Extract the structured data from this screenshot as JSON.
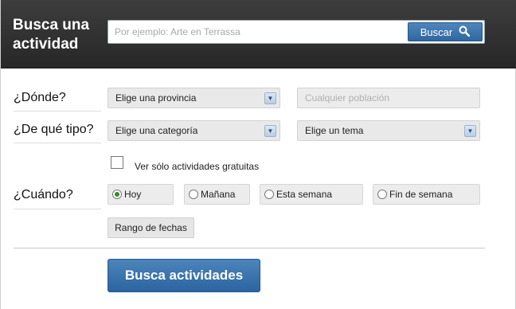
{
  "header": {
    "title": "Busca una actividad",
    "search_placeholder": "Por ejemplo: Arte en Terrassa",
    "search_button": "Buscar"
  },
  "where": {
    "label": "¿Dónde?",
    "province": "Elige una provincia",
    "town_placeholder": "Cualquier población"
  },
  "type": {
    "label": "¿De qué tipo?",
    "category": "Elige una categoría",
    "topic": "Elige un tema"
  },
  "free_only": {
    "label": "Ver sólo actividades gratuitas",
    "checked": false
  },
  "when": {
    "label": "¿Cuándo?",
    "options": [
      {
        "label": "Hoy",
        "checked": true
      },
      {
        "label": "Mañana",
        "checked": false
      },
      {
        "label": "Esta semana",
        "checked": false
      },
      {
        "label": "Fin de semana",
        "checked": false
      }
    ],
    "date_range": "Rango de fechas"
  },
  "submit": "Busca actividades"
}
